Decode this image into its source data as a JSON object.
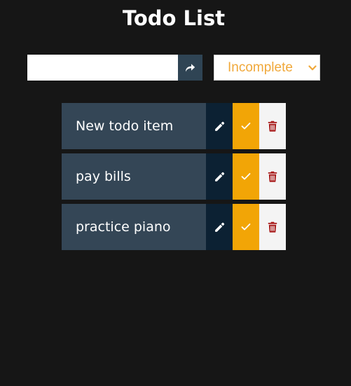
{
  "header": {
    "title": "Todo List"
  },
  "form": {
    "input_value": "",
    "submit_icon": "share-arrow-icon",
    "filter": {
      "selected": "Incomplete",
      "color": "#f0a83a"
    }
  },
  "todos": [
    {
      "text": "New todo item"
    },
    {
      "text": "pay bills"
    },
    {
      "text": "practice piano"
    }
  ],
  "icons": {
    "edit": "pencil-icon",
    "complete": "check-icon",
    "delete": "trash-icon"
  },
  "colors": {
    "background": "#161616",
    "todo_item": "#344656",
    "edit_button": "#0c2133",
    "complete_button": "#f2a506",
    "delete_button": "#f4f4f4",
    "delete_icon": "#a91d1d"
  }
}
